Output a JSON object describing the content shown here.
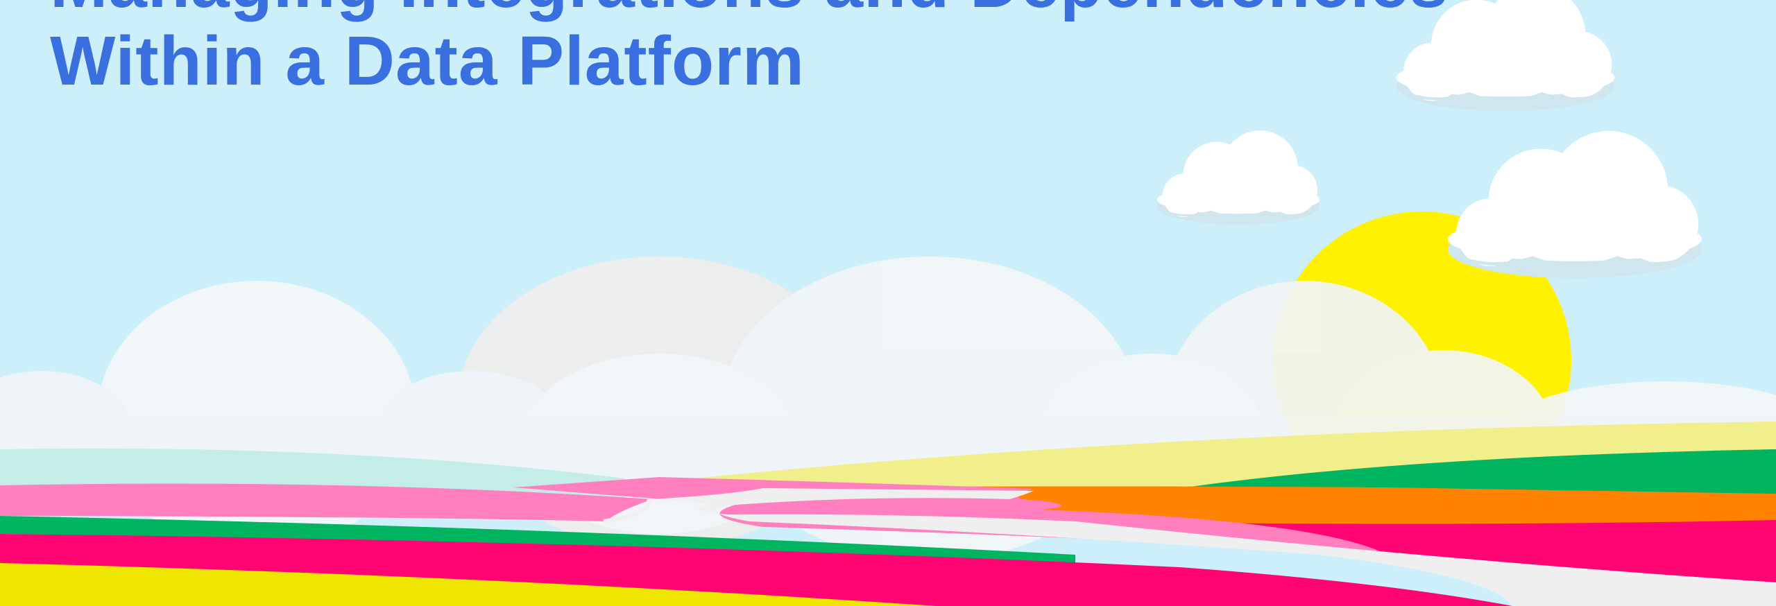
{
  "title": {
    "line1": "Managing Integrations and Dependencies",
    "line2": "Within a Data Platform"
  },
  "colors": {
    "sky": "#cdeff9",
    "title": "#3a6fe0",
    "sun": "#fff200",
    "hill_pale_yellow": "#f1ef8b",
    "stripe_green": "#00b460",
    "stripe_orange": "#ff8300",
    "stripe_pink": "#ff7fbf",
    "stripe_magenta": "#ff0473",
    "stripe_yellow": "#eee600",
    "road": "#f0f0f0"
  },
  "icons": [
    "sun-icon",
    "cloud-icon",
    "cloud-icon",
    "cloud-icon"
  ]
}
